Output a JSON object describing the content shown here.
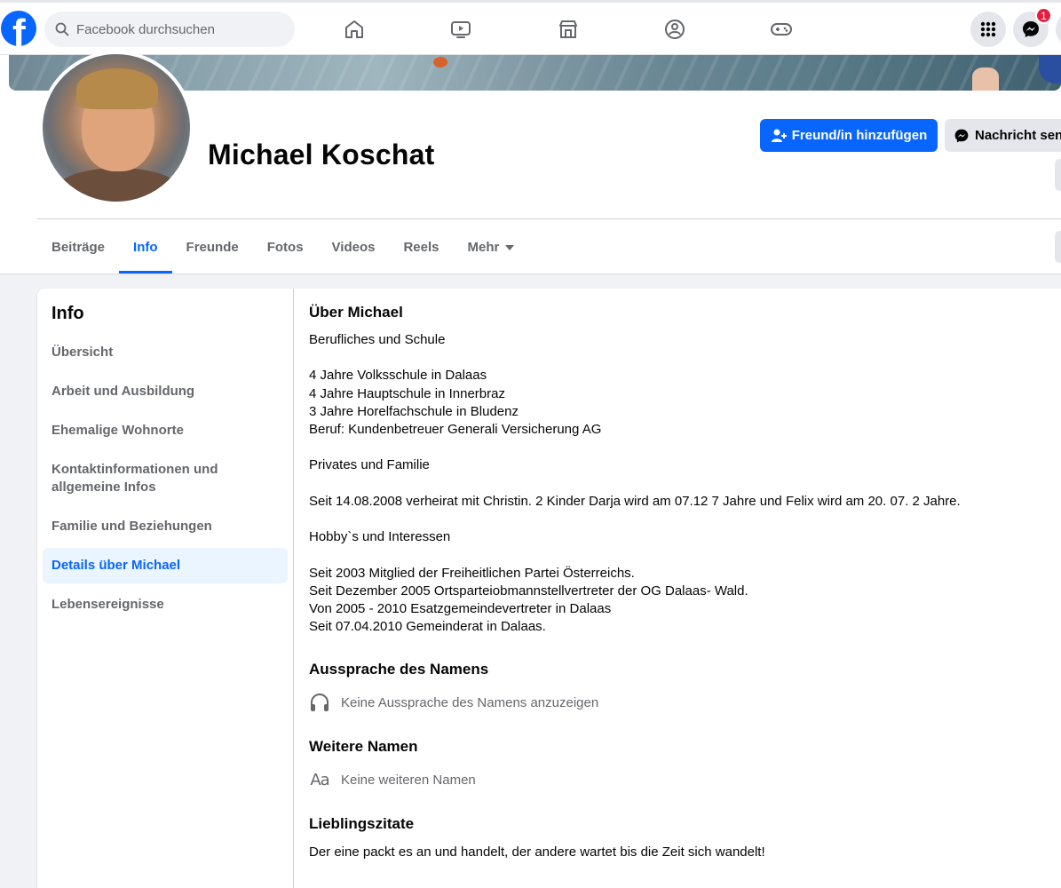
{
  "topnav": {
    "logo": "f",
    "search_placeholder": "Facebook durchsuchen",
    "icons": [
      "home-icon",
      "watch-icon",
      "marketplace-icon",
      "groups-icon",
      "gaming-icon"
    ],
    "messenger_badge": "1"
  },
  "profile": {
    "name": "Michael Koschat",
    "add_friend_label": "Freund/in hinzufügen",
    "message_label": "Nachricht senden"
  },
  "tabs": {
    "posts": "Beiträge",
    "info": "Info",
    "friends": "Freunde",
    "photos": "Fotos",
    "videos": "Videos",
    "reels": "Reels",
    "more": "Mehr"
  },
  "sidebar": {
    "title": "Info",
    "items": [
      "Übersicht",
      "Arbeit und Ausbildung",
      "Ehemalige Wohnorte",
      "Kontaktinformationen und allgemeine Infos",
      "Familie und Beziehungen",
      "Details über Michael",
      "Lebensereignisse"
    ]
  },
  "details": {
    "about_title": "Über Michael",
    "about_text": "Berufliches und Schule\n\n4 Jahre Volksschule in Dalaas\n4 Jahre Hauptschule in Innerbraz\n3 Jahre Horelfachschule in Bludenz\nBeruf: Kundenbetreuer Generali Versicherung AG\n\nPrivates und Familie\n\nSeit 14.08.2008 verheirat mit Christin. 2 Kinder Darja wird am 07.12 7 Jahre und Felix wird am 20. 07. 2 Jahre.\n\nHobby`s und Interessen\n\nSeit 2003 Mitglied der Freiheitlichen Partei Österreichs.\nSeit Dezember 2005 Ortsparteiobmannstellvertreter der OG Dalaas- Wald.\nVon 2005 - 2010 Esatzgemeindevertreter in Dalaas\nSeit 07.04.2010 Gemeinderat in Dalaas.",
    "pronunciation_title": "Aussprache des Namens",
    "pronunciation_text": "Keine Aussprache des Namens anzuzeigen",
    "other_names_title": "Weitere Namen",
    "other_names_icon": "Aa",
    "other_names_text": "Keine weiteren Namen",
    "quotes_title": "Lieblingszitate",
    "quotes_text": "Der eine packt es an und handelt, der andere wartet bis die Zeit sich wandelt!"
  },
  "colors": {
    "brand_blue": "#0866ff",
    "active_bg": "#ebf5ff",
    "page_bg": "#f0f2f5",
    "badge_red": "#e41e3f"
  }
}
